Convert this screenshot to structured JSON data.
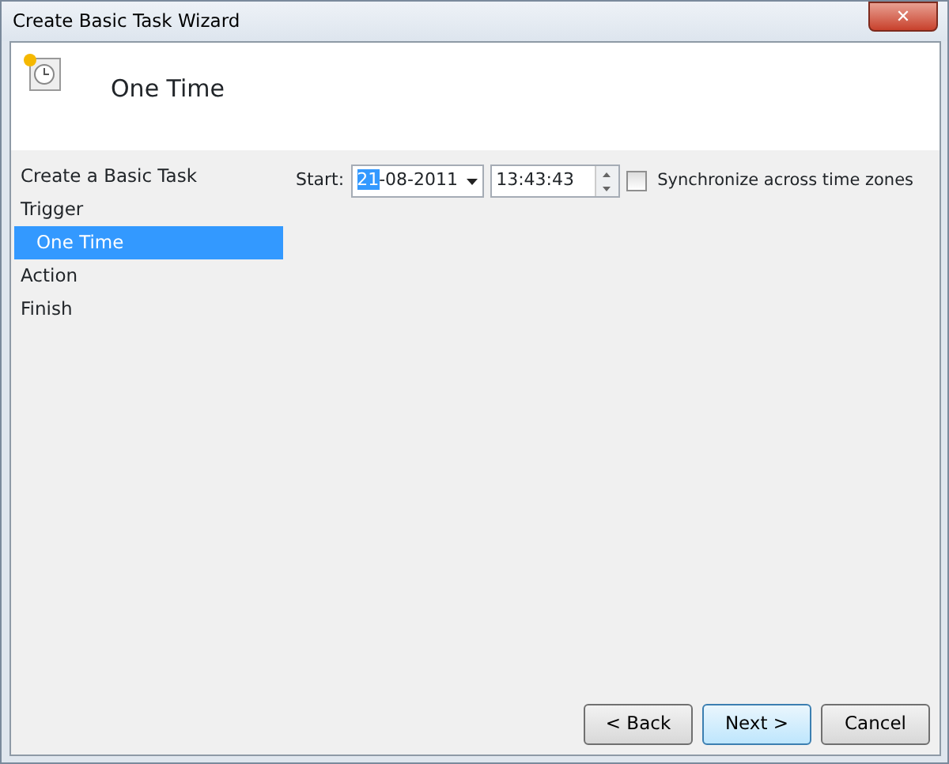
{
  "window": {
    "title": "Create Basic Task Wizard",
    "close": "✕"
  },
  "header": {
    "title": "One Time"
  },
  "steps": [
    {
      "label": "Create a Basic Task",
      "selected": false
    },
    {
      "label": "Trigger",
      "selected": false,
      "children": [
        {
          "label": "One Time",
          "selected": true
        }
      ]
    },
    {
      "label": "Action",
      "selected": false
    },
    {
      "label": "Finish",
      "selected": false
    }
  ],
  "start": {
    "label": "Start:",
    "date_selected_part": "21",
    "date_rest": "-08-2011",
    "time": "13:43:43",
    "sync_label": "Synchronize across time zones",
    "sync_checked": false
  },
  "buttons": [
    {
      "label": "< Back",
      "default": false
    },
    {
      "label": "Next >",
      "default": true
    },
    {
      "label": "Cancel",
      "default": false
    }
  ]
}
